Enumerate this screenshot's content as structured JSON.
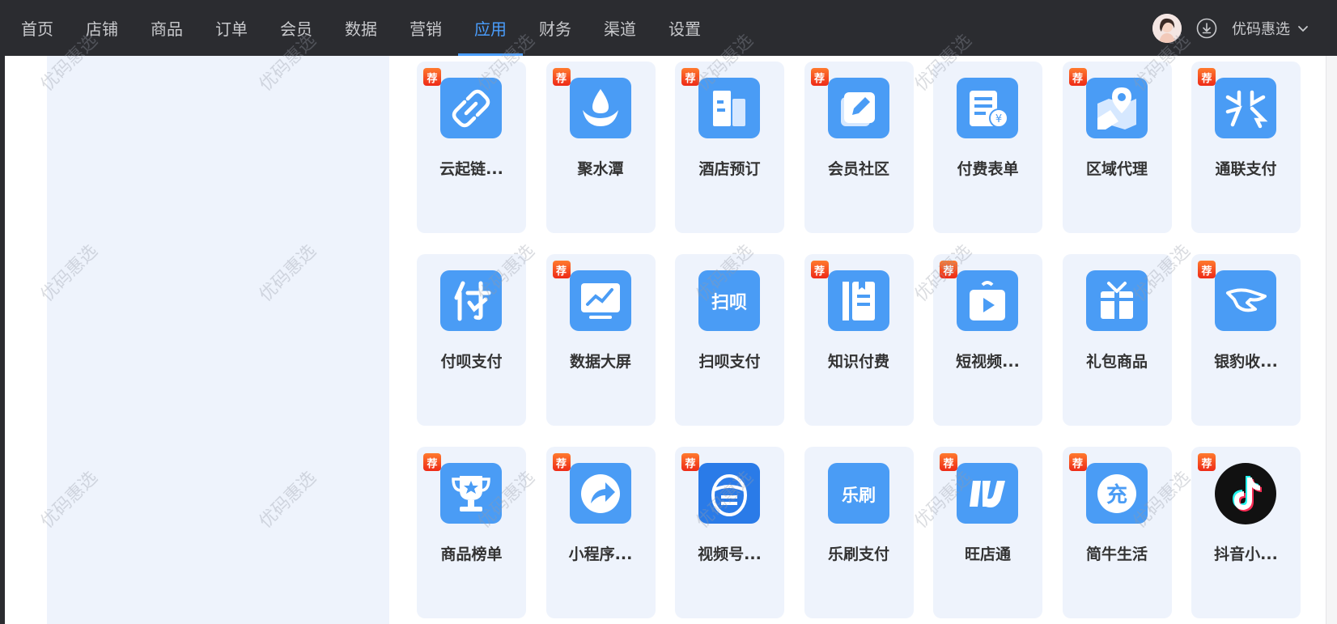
{
  "nav": {
    "items": [
      {
        "label": "首页"
      },
      {
        "label": "店铺"
      },
      {
        "label": "商品"
      },
      {
        "label": "订单"
      },
      {
        "label": "会员"
      },
      {
        "label": "数据"
      },
      {
        "label": "营销"
      },
      {
        "label": "应用",
        "active": true
      },
      {
        "label": "财务"
      },
      {
        "label": "渠道"
      },
      {
        "label": "设置"
      }
    ]
  },
  "header": {
    "store_name": "优码惠选"
  },
  "badge_text": "荐",
  "watermark_text": "优码惠选",
  "apps": [
    {
      "label": "云起链...",
      "badge": true,
      "icon": "link-icon"
    },
    {
      "label": "聚水潭",
      "badge": true,
      "icon": "water-drop-icon"
    },
    {
      "label": "酒店预订",
      "badge": true,
      "icon": "building-icon"
    },
    {
      "label": "会员社区",
      "badge": true,
      "icon": "edit-icon"
    },
    {
      "label": "付费表单",
      "badge": false,
      "icon": "paid-form-icon"
    },
    {
      "label": "区域代理",
      "badge": true,
      "icon": "map-pin-icon"
    },
    {
      "label": "通联支付",
      "badge": true,
      "icon": "tonglian-icon"
    },
    {
      "label": "付呗支付",
      "badge": false,
      "icon": "fubei-icon"
    },
    {
      "label": "数据大屏",
      "badge": true,
      "icon": "data-screen-icon"
    },
    {
      "label": "扫呗支付",
      "badge": false,
      "icon": "saobei-icon"
    },
    {
      "label": "知识付费",
      "badge": true,
      "icon": "book-icon"
    },
    {
      "label": "短视频...",
      "badge": true,
      "icon": "video-play-icon"
    },
    {
      "label": "礼包商品",
      "badge": false,
      "icon": "gift-icon"
    },
    {
      "label": "银豹收...",
      "badge": true,
      "icon": "leopard-icon"
    },
    {
      "label": "商品榜单",
      "badge": true,
      "icon": "trophy-icon"
    },
    {
      "label": "小程序...",
      "badge": true,
      "icon": "share-arrow-icon"
    },
    {
      "label": "视频号...",
      "badge": true,
      "icon": "video-account-icon"
    },
    {
      "label": "乐刷支付",
      "badge": false,
      "icon": "leshua-icon"
    },
    {
      "label": "旺店通",
      "badge": true,
      "icon": "wangdiantong-icon"
    },
    {
      "label": "简牛生活",
      "badge": true,
      "icon": "chong-icon"
    },
    {
      "label": "抖音小...",
      "badge": true,
      "icon": "douyin-icon"
    }
  ]
}
